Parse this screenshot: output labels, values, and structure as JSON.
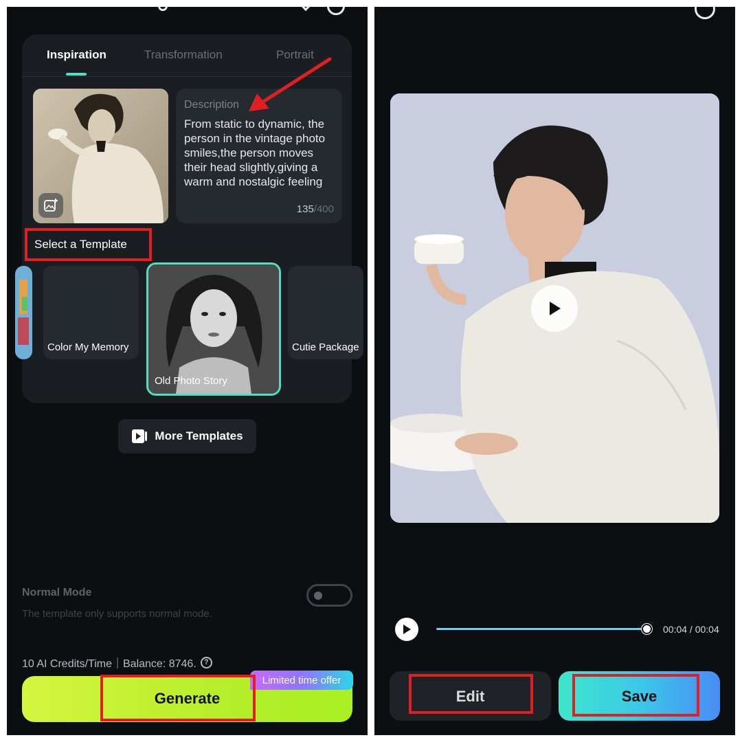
{
  "left": {
    "tabs": [
      {
        "label": "Inspiration",
        "active": true
      },
      {
        "label": "Transformation",
        "active": false
      },
      {
        "label": "Portrait",
        "active": false
      }
    ],
    "description": {
      "label": "Description",
      "text": "From static to dynamic, the person in the vintage photo smiles,the person moves their head slightly,giving a warm and nostalgic feeling",
      "count": "135",
      "max": "/400"
    },
    "select_template_label": "Select a Template",
    "templates": [
      {
        "label": "Color My Memory"
      },
      {
        "label": "Old Photo Story",
        "selected": true
      },
      {
        "label": "Cutie Package"
      }
    ],
    "more_templates_label": "More Templates",
    "mode": {
      "title": "Normal Mode",
      "subtitle": "The template only supports normal mode.",
      "enabled": false
    },
    "credits_text": "10 AI Credits/Time｜Balance: 8746.",
    "generate_label": "Generate",
    "offer_label": "Limited time offer"
  },
  "right": {
    "time_display": "00:04 / 00:04",
    "progress": 1.0,
    "edit_label": "Edit",
    "save_label": "Save"
  },
  "colors": {
    "accent_teal": "#4fe0c3",
    "highlight_red": "#e02020",
    "generate_green": "#b6ee2a"
  }
}
